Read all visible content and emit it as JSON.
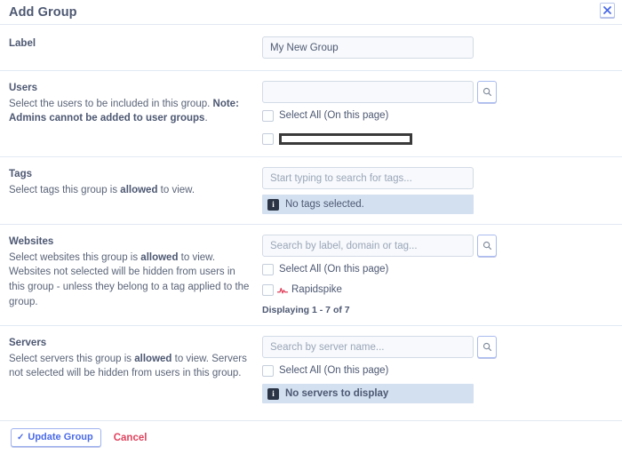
{
  "header": {
    "title": "Add Group",
    "close_icon": "close-icon"
  },
  "sections": {
    "label": {
      "title": "Label",
      "value": "My New Group"
    },
    "users": {
      "title": "Users",
      "desc_part1": "Select the users to be included in this group. ",
      "desc_bold": "Note: Admins cannot be added to user groups",
      "desc_part2": ".",
      "search_placeholder": "",
      "search_value": "",
      "select_all_label": "Select All (On this page)",
      "redacted_item_label": ""
    },
    "tags": {
      "title": "Tags",
      "desc_part1": "Select tags this group is ",
      "desc_bold": "allowed",
      "desc_part2": " to view.",
      "search_placeholder": "Start typing to search for tags...",
      "info_text": "No tags selected."
    },
    "websites": {
      "title": "Websites",
      "desc_part1": "Select websites this group is ",
      "desc_bold": "allowed",
      "desc_part2": " to view. Websites not selected will be hidden from users in this group - unless they belong to a tag applied to the group.",
      "search_placeholder": "Search by label, domain or tag...",
      "select_all_label": "Select All (On this page)",
      "item_label": "Rapidspike",
      "displaying": "Displaying 1 - 7 of 7"
    },
    "servers": {
      "title": "Servers",
      "desc_part1": "Select servers this group is ",
      "desc_bold": "allowed",
      "desc_part2": " to view. Servers not selected will be hidden from users in this group.",
      "search_placeholder": "Search by server name...",
      "select_all_label": "Select All (On this page)",
      "info_text": "No servers to display"
    }
  },
  "footer": {
    "update_label": "Update Group",
    "update_check_icon": "check-icon",
    "cancel_label": "Cancel"
  },
  "colors": {
    "accent_blue": "#4a6ae8",
    "danger_red": "#e0435e",
    "text_dark": "#4d5872",
    "divider": "#e2e9f3",
    "info_bg": "#d3e0f0",
    "favicon_red": "#e0435e"
  }
}
